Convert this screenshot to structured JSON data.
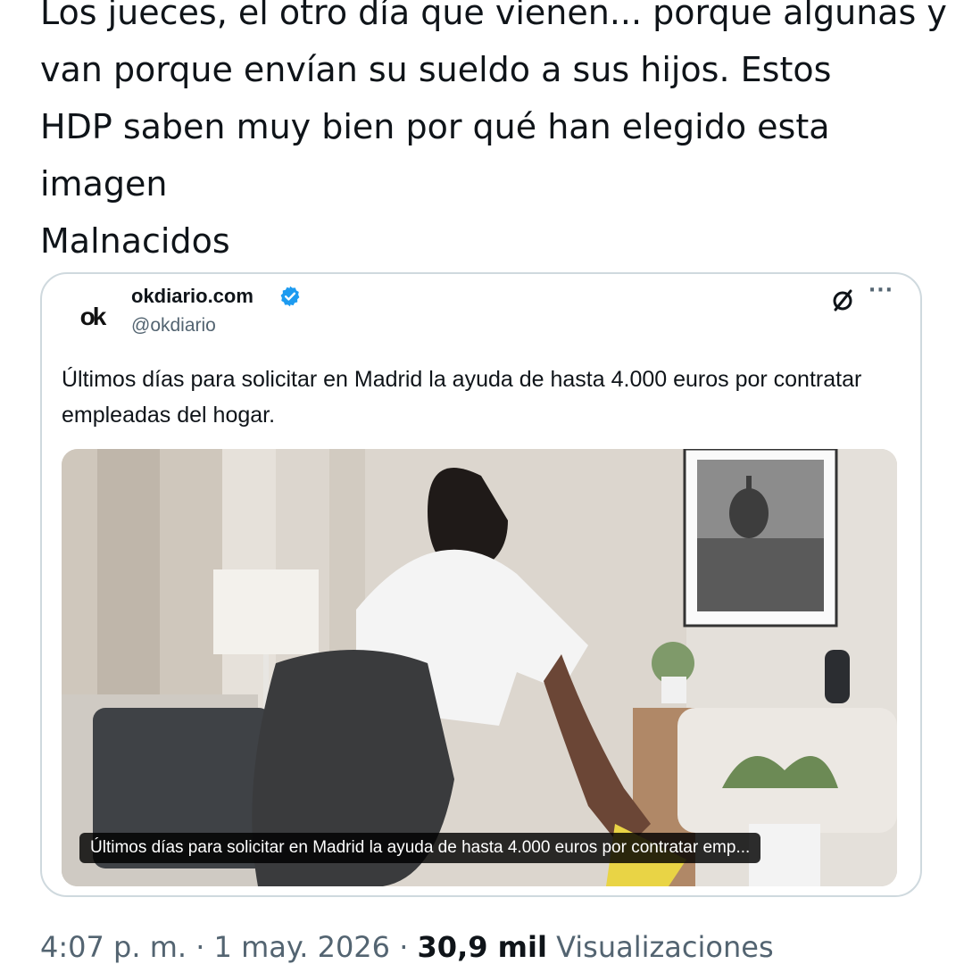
{
  "tweet": {
    "lines": [
      "Los jueces, el otro día que vienen... porque algunas y",
      "van porque envían su sueldo a sus hijos. Estos",
      "HDP saben muy bien por qué han elegido esta",
      "imagen",
      "Malnacidos"
    ]
  },
  "quoted": {
    "display_name": "okdiario.com",
    "handle": "@okdiario",
    "logo_text": "ok",
    "verified": true,
    "text": "Últimos días para solicitar en Madrid la ayuda de hasta 4.000 euros por contratar empleadas del hogar.",
    "media_caption": "Últimos días para solicitar en Madrid la ayuda de hasta 4.000 euros por contratar emp...",
    "icons": [
      "grok-icon",
      "more-icon"
    ]
  },
  "meta": {
    "time": "4:07 p. m.",
    "sep": "·",
    "date": "1 may. 2026",
    "views": "30,9 mil",
    "views_label": "Visualizaciones"
  },
  "colors": {
    "text": "#0f1419",
    "muted": "#536471",
    "border": "#cfd9de",
    "verified": "#1d9bf0"
  }
}
